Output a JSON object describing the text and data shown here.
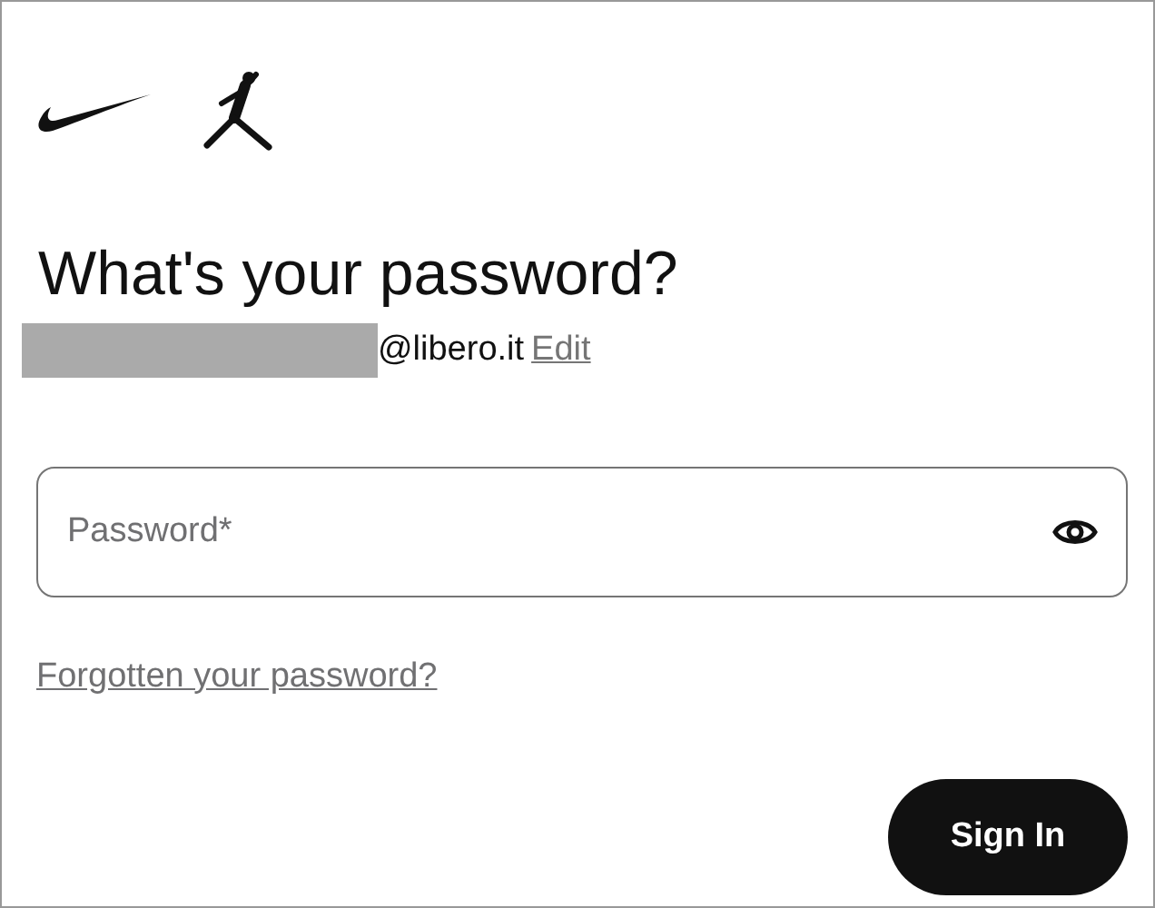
{
  "heading": "What's your password?",
  "account": {
    "email_suffix": "@libero.it",
    "edit_link": "Edit"
  },
  "password_field": {
    "placeholder": "Password*"
  },
  "forgot_link": "Forgotten your password?",
  "buttons": [
    "Sign In"
  ]
}
